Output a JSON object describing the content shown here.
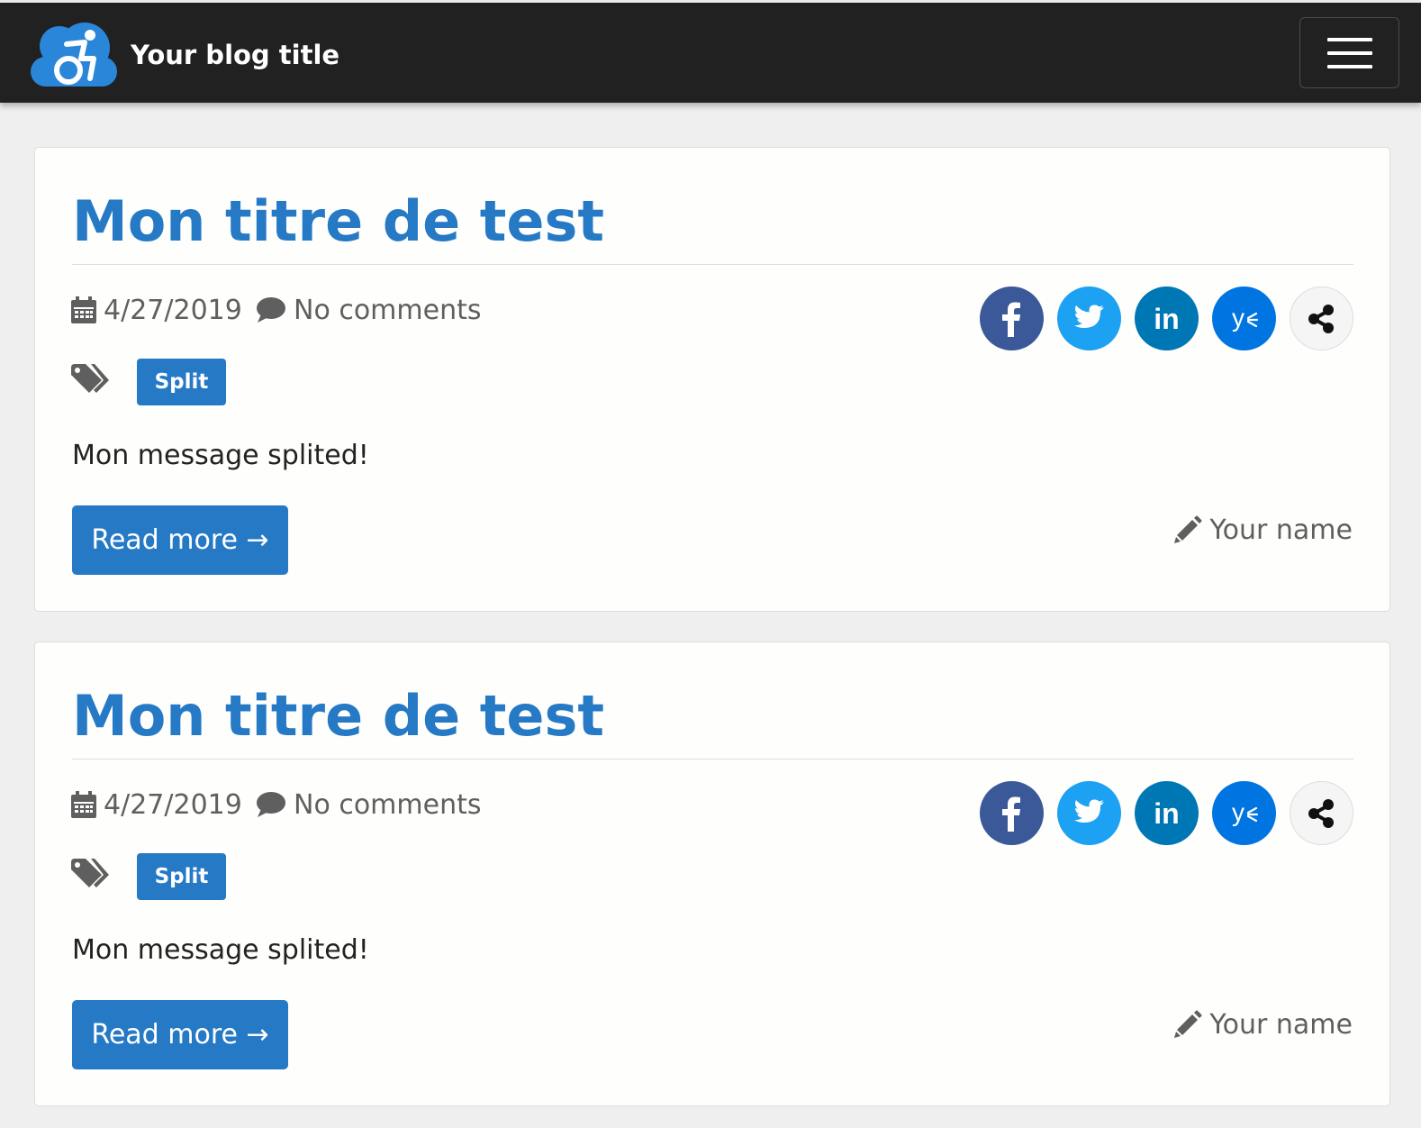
{
  "navbar": {
    "title": "Your blog title"
  },
  "posts": [
    {
      "title": "Mon titre de test",
      "date": "4/27/2019",
      "comments": "No comments",
      "tag": "Split",
      "message": "Mon message splited!",
      "read_more": "Read more →",
      "author": "Your name"
    },
    {
      "title": "Mon titre de test",
      "date": "4/27/2019",
      "comments": "No comments",
      "tag": "Split",
      "message": "Mon message splited!",
      "read_more": "Read more →",
      "author": "Your name"
    }
  ],
  "icons": {
    "brand": "accessibility-cloud-logo",
    "menu": "hamburger-menu-icon",
    "date": "calendar-icon",
    "comments": "comment-icon",
    "tags": "tags-icon",
    "author": "pencil-icon",
    "share": [
      "facebook-icon",
      "twitter-icon",
      "linkedin-icon",
      "yammer-icon",
      "share-icon"
    ]
  },
  "colors": {
    "navbar_bg": "#212121",
    "accent": "#2579c5",
    "page_bg": "#efefef",
    "muted_text": "#5f5f5f",
    "facebook": "#3b5998",
    "twitter": "#1da1f2",
    "linkedin": "#0077b5",
    "yammer": "#0074e0"
  }
}
